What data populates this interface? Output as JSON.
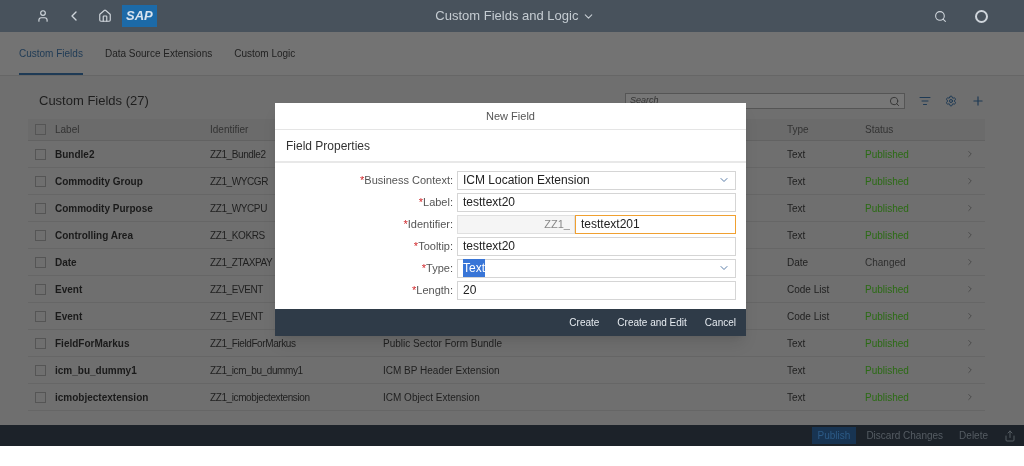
{
  "shell": {
    "logo": "SAP",
    "title": "Custom Fields and Logic"
  },
  "tabs": [
    {
      "label": "Custom Fields",
      "selected": true
    },
    {
      "label": "Data Source Extensions",
      "selected": false
    },
    {
      "label": "Custom Logic",
      "selected": false
    }
  ],
  "table": {
    "title": "Custom Fields (27)",
    "search": {
      "placeholder": "Search"
    },
    "columns": [
      "Label",
      "Identifier",
      "Type",
      "Status"
    ],
    "all_checked": false,
    "rows": [
      {
        "checked": false,
        "label": "Bundle2",
        "identifier": "ZZ1_Bundle2",
        "type": "Text",
        "status": "Published",
        "color": "#2b6b14"
      },
      {
        "checked": false,
        "label": "Commodity Group",
        "identifier": "ZZ1_WYCGR",
        "type": "Text",
        "status": "Published",
        "color": "#2b6b14"
      },
      {
        "checked": false,
        "label": "Commodity Purpose",
        "identifier": "ZZ1_WYCPU",
        "type": "Text",
        "status": "Published",
        "color": "#2b6b14"
      },
      {
        "checked": false,
        "label": "Controlling Area",
        "identifier": "ZZ1_KOKRS",
        "type": "Text",
        "status": "Published",
        "color": "#2b6b14"
      },
      {
        "checked": false,
        "label": "Date",
        "identifier": "ZZ1_ZTAXPAY",
        "type": "Date",
        "status": "Changed",
        "color": "#2e2e2e"
      },
      {
        "checked": false,
        "label": "Event",
        "identifier": "ZZ1_EVENT",
        "type": "Code List",
        "status": "Published",
        "color": "#2b6b14"
      },
      {
        "checked": false,
        "label": "Event",
        "identifier": "ZZ1_EVENT",
        "type": "Code List",
        "status": "Published",
        "color": "#2b6b14"
      },
      {
        "checked": false,
        "label": "FieldForMarkus",
        "identifier": "ZZ1_FieldForMarkus",
        "business_context": "Public Sector Form Bundle",
        "type": "Text",
        "status": "Published",
        "color": "#2b6b14"
      },
      {
        "checked": false,
        "label": "icm_bu_dummy1",
        "identifier": "ZZ1_icm_bu_dummy1",
        "business_context": "ICM BP Header Extension",
        "type": "Text",
        "status": "Published",
        "color": "#2b6b14"
      },
      {
        "checked": false,
        "label": "icmobjectextension",
        "identifier": "ZZ1_icmobjectextension",
        "business_context": "ICM Object Extension",
        "type": "Text",
        "status": "Published",
        "color": "#2b6b14"
      }
    ]
  },
  "footer": {
    "buttons": [
      {
        "label": "Publish",
        "emphasized": true
      },
      {
        "label": "Discard Changes",
        "emphasized": false
      },
      {
        "label": "Delete",
        "emphasized": false
      }
    ]
  },
  "dialog": {
    "title": "New Field",
    "section": "Field Properties",
    "fields": [
      {
        "kind": "dropdown",
        "marker": "*",
        "label": "Business Context:",
        "value": "ICM Location Extension",
        "focused": false,
        "value_selected": false
      },
      {
        "kind": "text",
        "marker": "*",
        "label": "Label:",
        "value": "testtext20",
        "focused": false,
        "value_selected": false
      },
      {
        "kind": "prefixed",
        "marker": "*",
        "label": "Identifier:",
        "prefix": "ZZ1_",
        "value": "testtext201",
        "focused": true,
        "value_selected": false
      },
      {
        "kind": "text",
        "marker": "*",
        "label": "Tooltip:",
        "value": "testtext20",
        "focused": false,
        "value_selected": false
      },
      {
        "kind": "dropdown",
        "marker": "*",
        "label": "Type:",
        "value": "Text",
        "focused": false,
        "value_selected": true
      },
      {
        "kind": "text",
        "marker": "*",
        "label": "Length:",
        "value": "20",
        "focused": false,
        "value_selected": false
      }
    ],
    "buttons": [
      "Create",
      "Create and Edit",
      "Cancel"
    ]
  }
}
